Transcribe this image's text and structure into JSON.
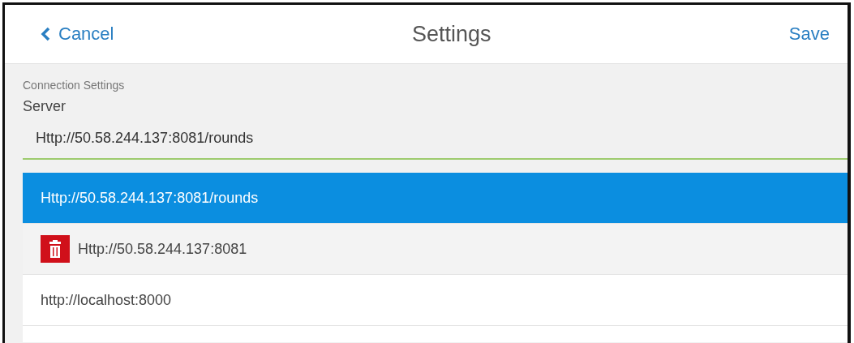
{
  "header": {
    "back_label": "Cancel",
    "title": "Settings",
    "save_label": "Save"
  },
  "section_label": "Connection Settings",
  "server": {
    "label": "Server",
    "value": "Http://50.58.244.137:8081/rounds"
  },
  "suggestions": [
    {
      "text": "Http://50.58.244.137:8081/rounds",
      "selected": true,
      "deletable": false
    },
    {
      "text": "Http://50.58.244.137:8081",
      "selected": false,
      "deletable": true
    },
    {
      "text": "http://localhost:8000",
      "selected": false,
      "deletable": false
    }
  ]
}
